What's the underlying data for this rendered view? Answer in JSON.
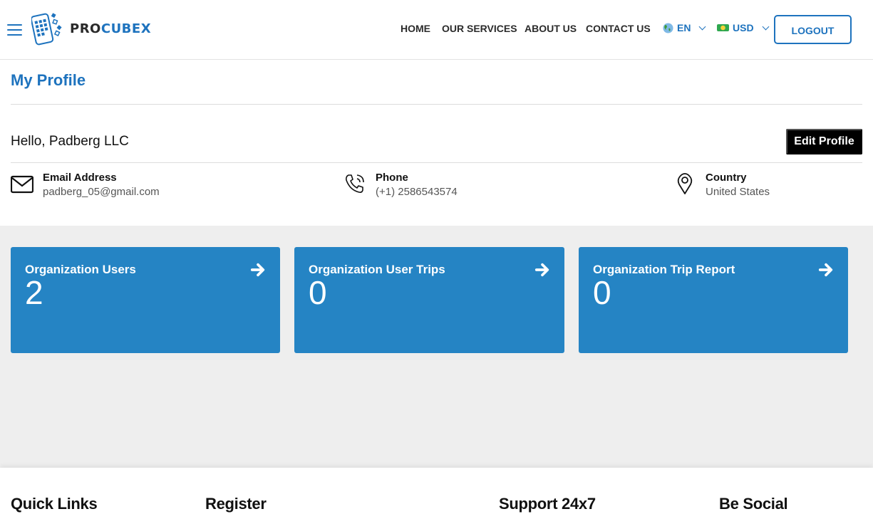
{
  "header": {
    "logo": {
      "prefix": "PRO",
      "suffix": "CUBEX"
    },
    "nav": [
      {
        "label": "HOME"
      },
      {
        "label": "OUR SERVICES"
      },
      {
        "label": "ABOUT US"
      },
      {
        "label": "CONTACT US"
      }
    ],
    "language": {
      "icon": "globe-icon",
      "value": "EN"
    },
    "currency": {
      "icon": "money-icon",
      "value": "USD"
    },
    "logout_label": "LOGOUT",
    "accent_color": "#1e73be"
  },
  "profile": {
    "title": "My Profile",
    "greeting": "Hello, Padberg LLC",
    "edit_label": "Edit Profile",
    "fields": [
      {
        "icon": "envelope-icon",
        "label": "Email Address",
        "value": "padberg_05@gmail.com"
      },
      {
        "icon": "phone-icon",
        "label": "Phone",
        "value": "(+1) 2586543574"
      },
      {
        "icon": "map-pin-icon",
        "label": "Country",
        "value": "United States"
      }
    ]
  },
  "cards": [
    {
      "title": "Organization Users",
      "value": "2"
    },
    {
      "title": "Organization User Trips",
      "value": "0"
    },
    {
      "title": "Organization Trip Report",
      "value": "0"
    }
  ],
  "card_color": "#2584c4",
  "footer": {
    "headings": [
      "Quick Links",
      "Register",
      "Support 24x7",
      "Be Social"
    ]
  }
}
